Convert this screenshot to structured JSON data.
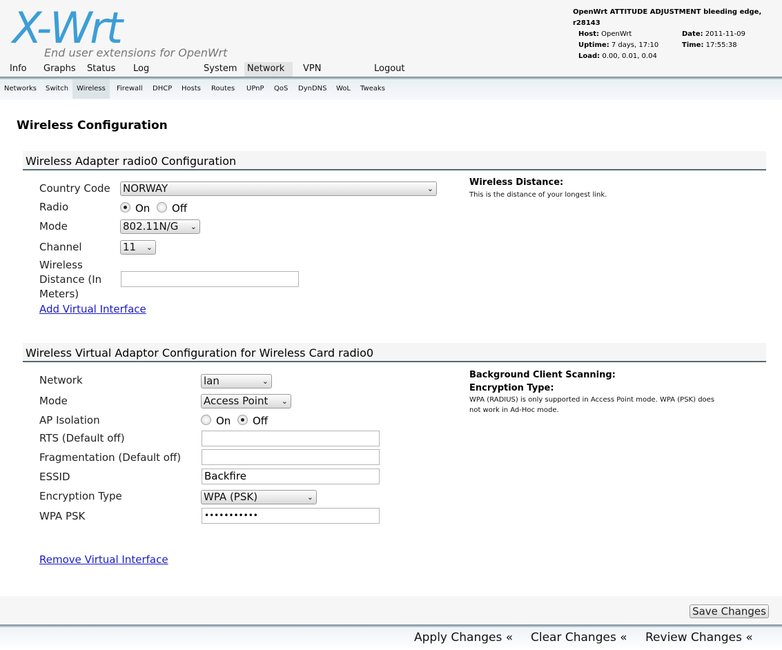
{
  "header": {
    "logo_text": "X-Wrt",
    "logo_subtitle": "End user extensions for OpenWrt",
    "version": "OpenWrt ATTITUDE ADJUSTMENT bleeding edge, r28143",
    "host_label": "Host:",
    "host_value": "OpenWrt",
    "date_label": "Date:",
    "date_value": "2011-11-09",
    "uptime_label": "Uptime:",
    "uptime_value": "7 days, 17:10",
    "time_label": "Time:",
    "time_value": "17:55:38",
    "load_label": "Load:",
    "load_value": "0.00, 0.01, 0.04"
  },
  "main_nav": {
    "info": "Info",
    "graphs": "Graphs",
    "status": "Status",
    "log": "Log",
    "system": "System",
    "network": "Network",
    "vpn": "VPN",
    "logout": "Logout",
    "active": "Network"
  },
  "sub_nav": {
    "networks": "Networks",
    "switch": "Switch",
    "wireless": "Wireless",
    "firewall": "Firewall",
    "dhcp": "DHCP",
    "hosts": "Hosts",
    "routes": "Routes",
    "upnp": "UPnP",
    "qos": "QoS",
    "dyndns": "DynDNS",
    "wol": "WoL",
    "tweaks": "Tweaks",
    "active": "Wireless"
  },
  "page_title": "Wireless Configuration",
  "adapter_section": {
    "title": "Wireless Adapter radio0 Configuration",
    "country_label": "Country Code",
    "country_value": "NORWAY",
    "radio_label": "Radio",
    "radio_on": "On",
    "radio_off": "Off",
    "radio_selected": "On",
    "mode_label": "Mode",
    "mode_value": "802.11N/G",
    "channel_label": "Channel",
    "channel_value": "11",
    "distance_label_1": "Wireless",
    "distance_label_2": "Distance (In",
    "distance_label_3": "Meters)",
    "distance_value": "",
    "add_link": "Add Virtual Interface",
    "help_title": "Wireless Distance:",
    "help_text": "This is the distance of your longest link."
  },
  "virtual_section": {
    "title": "Wireless Virtual Adaptor Configuration for Wireless Card radio0",
    "network_label": "Network",
    "network_value": "lan",
    "mode_label": "Mode",
    "mode_value": "Access Point",
    "ap_isolation_label": "AP Isolation",
    "ap_on": "On",
    "ap_off": "Off",
    "ap_selected": "Off",
    "rts_label": "RTS (Default off)",
    "rts_value": "",
    "frag_label": "Fragmentation (Default off)",
    "frag_value": "",
    "essid_label": "ESSID",
    "essid_value": "Backfire",
    "enc_label": "Encryption Type",
    "enc_value": "WPA (PSK)",
    "psk_label": "WPA PSK",
    "psk_value": "•••••••••••",
    "remove_link": "Remove Virtual Interface",
    "help_title_1": "Background Client Scanning:",
    "help_title_2": "Encryption Type:",
    "help_text_1": "WPA (RADIUS) is only supported in Access Point mode. WPA (PSK) does",
    "help_text_2": "not work in Ad-Hoc mode."
  },
  "footer": {
    "save": "Save Changes",
    "apply": "Apply Changes «",
    "clear": "Clear Changes «",
    "review": "Review Changes «"
  },
  "colors": {
    "logo_blue": "#3c9ed6",
    "link_blue": "#1a1ac8",
    "rule_slate": "#556a75"
  }
}
